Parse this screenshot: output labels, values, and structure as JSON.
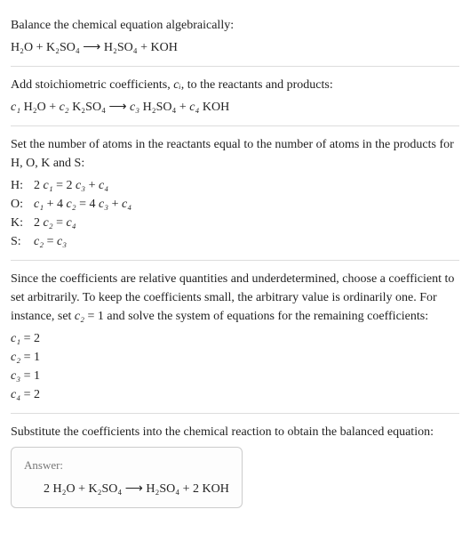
{
  "section1": {
    "intro": "Balance the chemical equation algebraically:",
    "equation": "H₂O + K₂SO₄ ⟶ H₂SO₄ + KOH"
  },
  "section2": {
    "intro_a": "Add stoichiometric coefficients, ",
    "intro_ci": "cᵢ",
    "intro_b": ", to the reactants and products:",
    "equation_c1": "c₁",
    "equation_sp1": " H₂O + ",
    "equation_c2": "c₂",
    "equation_sp2": " K₂SO₄ ⟶ ",
    "equation_c3": "c₃",
    "equation_sp3": " H₂SO₄ + ",
    "equation_c4": "c₄",
    "equation_sp4": " KOH"
  },
  "section3": {
    "intro": "Set the number of atoms in the reactants equal to the number of atoms in the products for H, O, K and S:",
    "rows": [
      {
        "label": "H:",
        "eq_pre": "2 ",
        "c1": "c₁",
        "mid1": " = 2 ",
        "c3": "c₃",
        "mid2": " + ",
        "c4": "c₄"
      },
      {
        "label": "O:",
        "c1": "c₁",
        "mid0": " + 4 ",
        "c2": "c₂",
        "mid1": " = 4 ",
        "c3": "c₃",
        "mid2": " + ",
        "c4": "c₄"
      },
      {
        "label": "K:",
        "eq_pre": "2 ",
        "c2": "c₂",
        "mid1": " = ",
        "c4": "c₄"
      },
      {
        "label": "S:",
        "c2": "c₂",
        "mid1": " = ",
        "c3": "c₃"
      }
    ]
  },
  "section4": {
    "intro_a": "Since the coefficients are relative quantities and underdetermined, choose a coefficient to set arbitrarily. To keep the coefficients small, the arbitrary value is ordinarily one. For instance, set ",
    "intro_c2": "c₂",
    "intro_b": " = 1 and solve the system of equations for the remaining coefficients:",
    "coeffs": [
      {
        "c": "c₁",
        "v": " = 2"
      },
      {
        "c": "c₂",
        "v": " = 1"
      },
      {
        "c": "c₃",
        "v": " = 1"
      },
      {
        "c": "c₄",
        "v": " = 2"
      }
    ]
  },
  "section5": {
    "intro": "Substitute the coefficients into the chemical reaction to obtain the balanced equation:",
    "answer_label": "Answer:",
    "answer_eq": "2 H₂O + K₂SO₄ ⟶ H₂SO₄ + 2 KOH"
  }
}
